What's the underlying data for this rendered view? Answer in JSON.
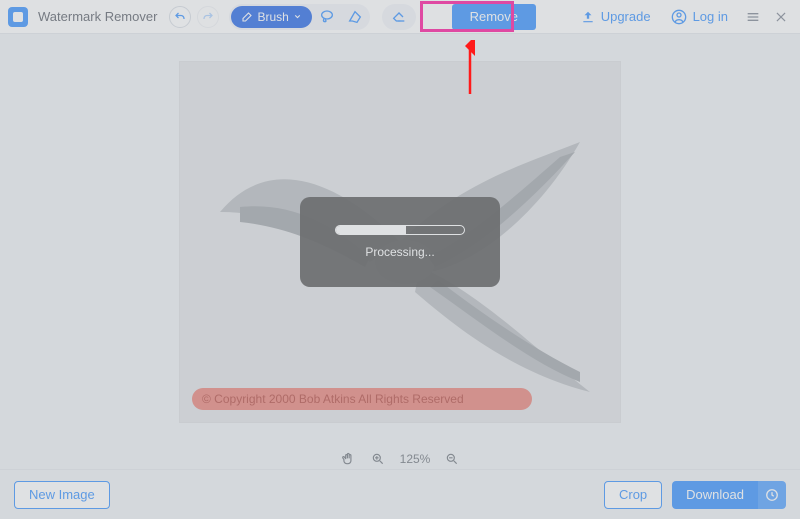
{
  "app": {
    "title": "Watermark Remover"
  },
  "toolbar": {
    "brush_label": "Brush",
    "remove_label": "Remove",
    "upgrade_label": "Upgrade",
    "login_label": "Log in"
  },
  "canvas": {
    "watermark_text": "© Copyright  2000  Bob Atkins  All Rights Reserved"
  },
  "overlay": {
    "processing_label": "Processing...",
    "progress_percent": 55
  },
  "zoom": {
    "level_label": "125%"
  },
  "footer": {
    "new_image_label": "New Image",
    "crop_label": "Crop",
    "download_label": "Download"
  },
  "colors": {
    "accent": "#2f8dff",
    "highlight": "#ff0a96",
    "mark": "#e9796e"
  }
}
